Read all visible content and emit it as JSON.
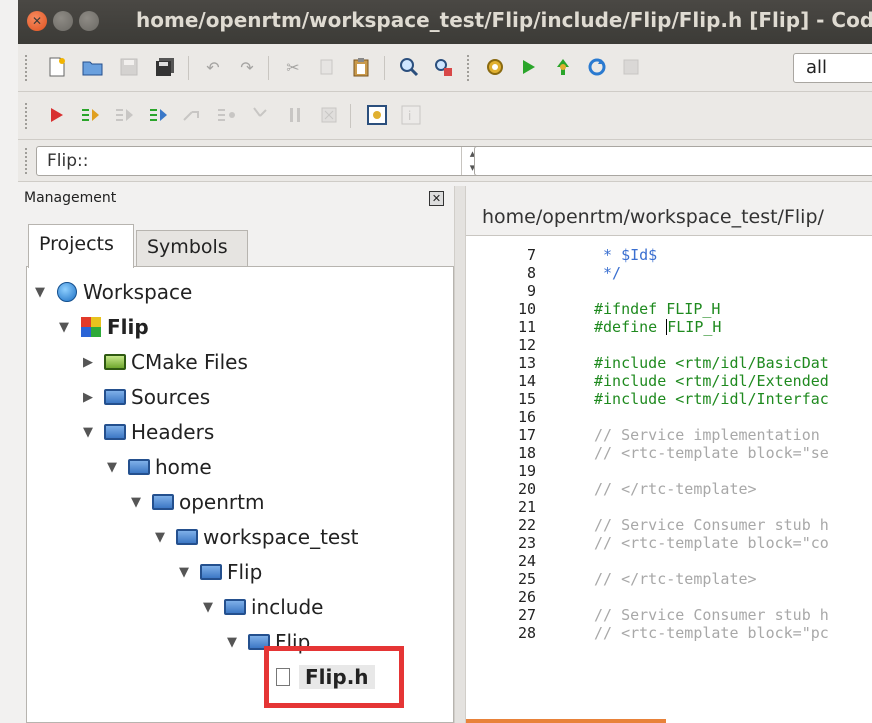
{
  "window": {
    "title": "home/openrtm/workspace_test/Flip/include/Flip/Flip.h [Flip] - Code::"
  },
  "toolbar": {
    "target_value": "all"
  },
  "scope": {
    "value": "Flip::"
  },
  "management": {
    "title": "Management",
    "tabs": [
      "Projects",
      "Symbols"
    ],
    "tree": [
      {
        "label": "Workspace",
        "level": 0,
        "expanded": true,
        "icon": "workspace-icon"
      },
      {
        "label": "Flip",
        "level": 1,
        "expanded": true,
        "icon": "project-icon",
        "bold": true
      },
      {
        "label": "CMake Files",
        "level": 2,
        "expanded": false,
        "icon": "folder-icon"
      },
      {
        "label": "Sources",
        "level": 2,
        "expanded": false,
        "icon": "folder-icon"
      },
      {
        "label": "Headers",
        "level": 2,
        "expanded": true,
        "icon": "folder-icon"
      },
      {
        "label": "home",
        "level": 3,
        "expanded": true,
        "icon": "folder-icon"
      },
      {
        "label": "openrtm",
        "level": 4,
        "expanded": true,
        "icon": "folder-icon"
      },
      {
        "label": "workspace_test",
        "level": 5,
        "expanded": true,
        "icon": "folder-icon"
      },
      {
        "label": "Flip",
        "level": 6,
        "expanded": true,
        "icon": "folder-icon"
      },
      {
        "label": "include",
        "level": 7,
        "expanded": true,
        "icon": "folder-icon"
      },
      {
        "label": "Flip",
        "level": 8,
        "expanded": true,
        "icon": "folder-icon"
      },
      {
        "label": "Flip.h",
        "level": 9,
        "icon": "file-icon",
        "selected": true,
        "bold": true
      }
    ]
  },
  "editor": {
    "tab_title": "home/openrtm/workspace_test/Flip/",
    "lines": [
      {
        "n": "7",
        "text": " * $Id$",
        "kind": "doc"
      },
      {
        "n": "8",
        "text": " */",
        "kind": "doc"
      },
      {
        "n": "9",
        "text": "",
        "kind": "plain"
      },
      {
        "n": "10",
        "text": "#ifndef FLIP_H",
        "kind": "pp"
      },
      {
        "n": "11",
        "text": "#define FLIP_H",
        "kind": "pp",
        "cursor_after": 8
      },
      {
        "n": "12",
        "text": "",
        "kind": "plain"
      },
      {
        "n": "13",
        "text": "#include <rtm/idl/BasicDat",
        "kind": "pp"
      },
      {
        "n": "14",
        "text": "#include <rtm/idl/Extended",
        "kind": "pp"
      },
      {
        "n": "15",
        "text": "#include <rtm/idl/Interfac",
        "kind": "pp"
      },
      {
        "n": "16",
        "text": "",
        "kind": "plain"
      },
      {
        "n": "17",
        "text": "// Service implementation ",
        "kind": "cm"
      },
      {
        "n": "18",
        "text": "// <rtc-template block=\"se",
        "kind": "cm"
      },
      {
        "n": "19",
        "text": "",
        "kind": "plain"
      },
      {
        "n": "20",
        "text": "// </rtc-template>",
        "kind": "cm"
      },
      {
        "n": "21",
        "text": "",
        "kind": "plain"
      },
      {
        "n": "22",
        "text": "// Service Consumer stub h",
        "kind": "cm"
      },
      {
        "n": "23",
        "text": "// <rtc-template block=\"co",
        "kind": "cm"
      },
      {
        "n": "24",
        "text": "",
        "kind": "plain"
      },
      {
        "n": "25",
        "text": "// </rtc-template>",
        "kind": "cm"
      },
      {
        "n": "26",
        "text": "",
        "kind": "plain"
      },
      {
        "n": "27",
        "text": "// Service Consumer stub h",
        "kind": "cm"
      },
      {
        "n": "28",
        "text": "// <rtc-template block=\"pc",
        "kind": "cm"
      }
    ]
  },
  "colors": {
    "highlight": "#e53535",
    "preprocessor": "#1f8a1f",
    "comment": "#a8a8a8"
  }
}
